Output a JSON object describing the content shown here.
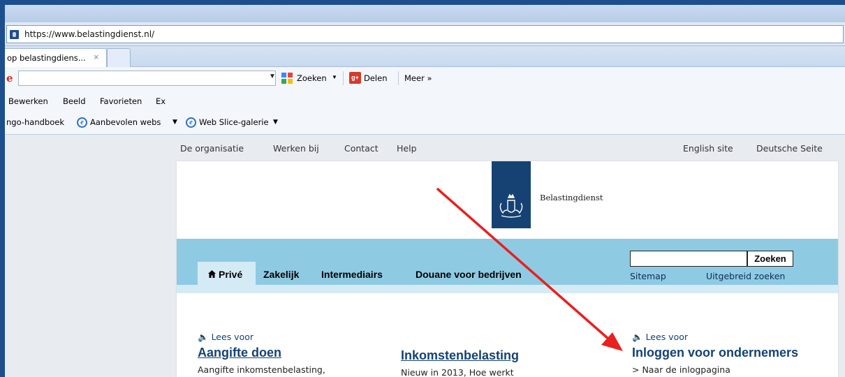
{
  "browser": {
    "address": "https://www.belastingdienst.nl/",
    "tab_title": "op belastingdiens...",
    "tab_close": "×"
  },
  "toolbar": {
    "brand_letter": "e",
    "search_label": "Zoeken",
    "share_label": "Delen",
    "more_label": "Meer »"
  },
  "menu": [
    "Bewerken",
    "Beeld",
    "Favorieten",
    "Ex"
  ],
  "favorites": {
    "item1": "ngo-handboek",
    "item2": "Aanbevolen webs",
    "item3": "Web Slice-galerie"
  },
  "site": {
    "top_links": [
      "De organisatie",
      "Werken bij",
      "Contact",
      "Help"
    ],
    "lang_links": [
      "English site",
      "Deutsche Seite"
    ],
    "logo_text": "Belastingdienst",
    "nav": [
      "Privé",
      "Zakelijk",
      "Intermediairs",
      "Douane voor bedrijven"
    ],
    "search_button": "Zoeken",
    "sitemap": "Sitemap",
    "advanced_search": "Uitgebreid zoeken",
    "columns": [
      {
        "lees": "Lees voor",
        "title": "Aangifte doen",
        "text": "Aangifte inkomstenbelasting,"
      },
      {
        "title": "Inkomstenbelasting",
        "text": "Nieuw in 2013, Hoe werkt"
      },
      {
        "lees": "Lees voor",
        "title": "Inloggen voor ondernemers",
        "text": "> Naar de inlogpagina"
      }
    ]
  },
  "colors": {
    "accent_blue": "#154273",
    "nav_band": "#8fcae3",
    "arrow": "#e8201f"
  }
}
